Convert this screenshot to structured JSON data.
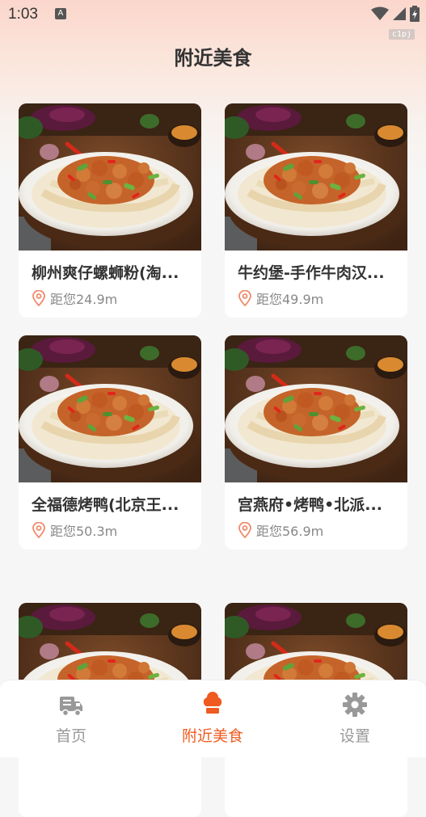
{
  "status_bar": {
    "time": "1:03",
    "notif_glyph": "A",
    "watermark": "c1pj"
  },
  "header": {
    "title": "附近美食"
  },
  "colors": {
    "accent": "#ef5a1f",
    "inactive": "#999999",
    "pin": "#f08a6a"
  },
  "restaurants": [
    {
      "name": "柳州爽仔螺蛳粉(淘...",
      "distance": "距您24.9m"
    },
    {
      "name": "牛约堡-手作牛肉汉...",
      "distance": "距您49.9m"
    },
    {
      "name": "全福德烤鸭(北京王...",
      "distance": "距您50.3m"
    },
    {
      "name": "宫燕府•烤鸭•北派...",
      "distance": "距您56.9m"
    },
    {
      "name": "",
      "distance": ""
    },
    {
      "name": "",
      "distance": ""
    }
  ],
  "tabs": [
    {
      "label": "首页",
      "icon": "truck-icon",
      "active": false
    },
    {
      "label": "附近美食",
      "icon": "chef-hat-icon",
      "active": true
    },
    {
      "label": "设置",
      "icon": "gear-icon",
      "active": false
    }
  ]
}
